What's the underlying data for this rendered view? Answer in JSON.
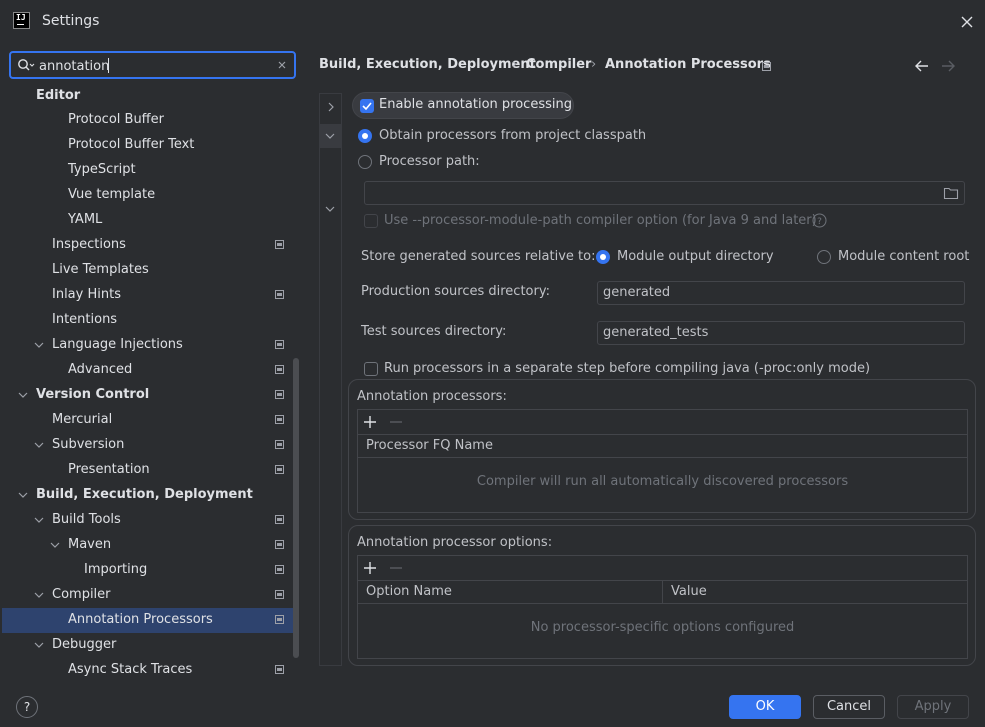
{
  "window": {
    "title": "Settings"
  },
  "search": {
    "value": "annotation"
  },
  "sidebar": {
    "items": [
      {
        "label": "Editor",
        "bold": true
      },
      {
        "label": "Protocol Buffer"
      },
      {
        "label": "Protocol Buffer Text"
      },
      {
        "label": "TypeScript"
      },
      {
        "label": "Vue template"
      },
      {
        "label": "YAML"
      },
      {
        "label": "Inspections"
      },
      {
        "label": "Live Templates"
      },
      {
        "label": "Inlay Hints"
      },
      {
        "label": "Intentions"
      },
      {
        "label": "Language Injections"
      },
      {
        "label": "Advanced"
      },
      {
        "label": "Version Control",
        "bold": true
      },
      {
        "label": "Mercurial"
      },
      {
        "label": "Subversion"
      },
      {
        "label": "Presentation"
      },
      {
        "label": "Build, Execution, Deployment",
        "bold": true
      },
      {
        "label": "Build Tools"
      },
      {
        "label": "Maven"
      },
      {
        "label": "Importing"
      },
      {
        "label": "Compiler"
      },
      {
        "label": "Annotation Processors",
        "selected": true
      },
      {
        "label": "Debugger"
      },
      {
        "label": "Async Stack Traces"
      }
    ]
  },
  "breadcrumb": {
    "items": [
      "Build, Execution, Deployment",
      "Compiler",
      "Annotation Processors"
    ],
    "separator": "›"
  },
  "form": {
    "enable_processing": {
      "label": "Enable annotation processing",
      "checked": true
    },
    "obtain_from_classpath": {
      "label": "Obtain processors from project classpath",
      "selected": true
    },
    "processor_path": {
      "label": "Processor path:",
      "value": ""
    },
    "module_path_option": {
      "label": "Use --processor-module-path compiler option (for Java 9 and later)"
    },
    "store_generated": {
      "label": "Store generated sources relative to:",
      "option_output": "Module output directory",
      "option_content": "Module content root"
    },
    "production_dir": {
      "label": "Production sources directory:",
      "value": "generated"
    },
    "test_dir": {
      "label": "Test sources directory:",
      "value": "generated_tests"
    },
    "separate_step": {
      "label": "Run processors in a separate step before compiling java (-proc:only mode)"
    }
  },
  "processors_panel": {
    "title": "Annotation processors:",
    "column": "Processor FQ Name",
    "empty_text": "Compiler will run all automatically discovered processors"
  },
  "options_panel": {
    "title": "Annotation processor options:",
    "columns": [
      "Option Name",
      "Value"
    ],
    "empty_text": "No processor-specific options configured"
  },
  "footer": {
    "help": "?",
    "ok": "OK",
    "cancel": "Cancel",
    "apply": "Apply"
  },
  "colors": {
    "accent": "#3574f0",
    "selection": "#2e436e",
    "background": "#2b2d30",
    "border": "#43454a"
  }
}
